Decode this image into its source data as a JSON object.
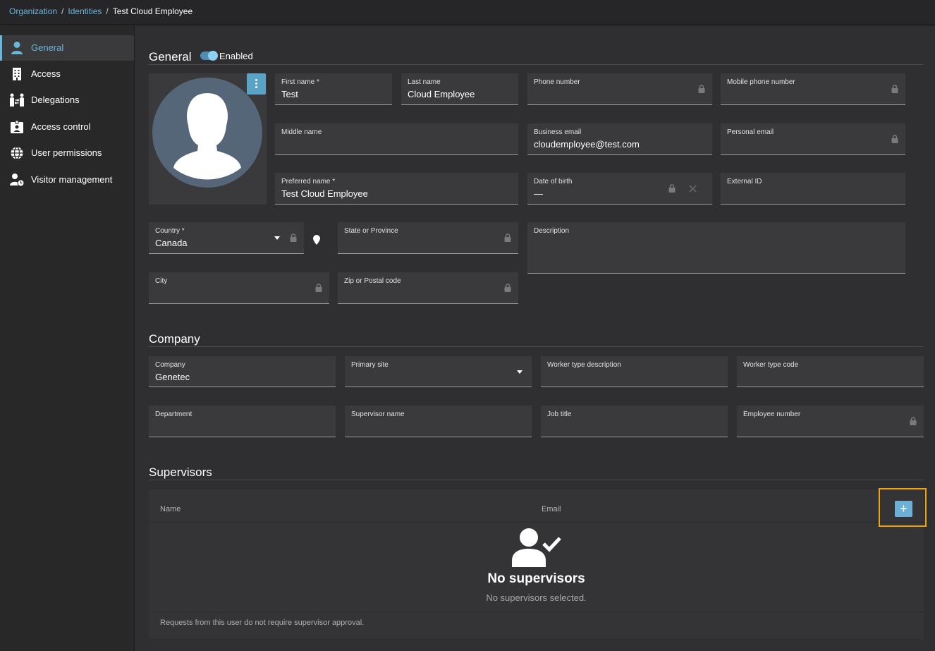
{
  "breadcrumb": {
    "items": [
      "Organization",
      "Identities"
    ],
    "current": "Test Cloud Employee",
    "separator": "/"
  },
  "sidebar": {
    "items": [
      {
        "label": "General",
        "icon": "person-icon",
        "active": true
      },
      {
        "label": "Access",
        "icon": "building-icon"
      },
      {
        "label": "Delegations",
        "icon": "delegation-icon"
      },
      {
        "label": "Access control",
        "icon": "badge-icon"
      },
      {
        "label": "User permissions",
        "icon": "globe-icon"
      },
      {
        "label": "Visitor management",
        "icon": "visitor-icon"
      }
    ]
  },
  "general": {
    "title": "General",
    "enabled_label": "Enabled",
    "enabled": true,
    "fields": {
      "first_name": {
        "label": "First name *",
        "value": "Test"
      },
      "last_name": {
        "label": "Last name",
        "value": "Cloud Employee"
      },
      "phone": {
        "label": "Phone number",
        "value": ""
      },
      "mobile": {
        "label": "Mobile phone number",
        "value": ""
      },
      "middle_name": {
        "label": "Middle name",
        "value": ""
      },
      "business_email": {
        "label": "Business email",
        "value": "cloudemployee@test.com"
      },
      "personal_email": {
        "label": "Personal email",
        "value": ""
      },
      "preferred_name": {
        "label": "Preferred name *",
        "value": "Test Cloud Employee"
      },
      "dob": {
        "label": "Date of birth",
        "value": "—"
      },
      "external_id": {
        "label": "External ID",
        "value": ""
      },
      "country": {
        "label": "Country *",
        "value": "Canada"
      },
      "state": {
        "label": "State or Province",
        "value": ""
      },
      "description": {
        "label": "Description",
        "value": ""
      },
      "city": {
        "label": "City",
        "value": ""
      },
      "zip": {
        "label": "Zip or Postal code",
        "value": ""
      }
    }
  },
  "company": {
    "title": "Company",
    "fields": {
      "company": {
        "label": "Company",
        "value": "Genetec"
      },
      "primary_site": {
        "label": "Primary site",
        "value": ""
      },
      "worker_type_desc": {
        "label": "Worker type description",
        "value": ""
      },
      "worker_type_code": {
        "label": "Worker type code",
        "value": ""
      },
      "department": {
        "label": "Department",
        "value": ""
      },
      "supervisor_name": {
        "label": "Supervisor name",
        "value": ""
      },
      "job_title": {
        "label": "Job title",
        "value": ""
      },
      "employee_number": {
        "label": "Employee number",
        "value": ""
      }
    }
  },
  "supervisors": {
    "title": "Supervisors",
    "columns": [
      "Name",
      "Email"
    ],
    "add_label": "+",
    "empty_title": "No supervisors",
    "empty_subtitle": "No supervisors selected.",
    "footnote": "Requests from this user do not require supervisor approval."
  },
  "colors": {
    "accent": "#6cb6dc",
    "highlight": "#f0a30a",
    "background": "#2f2f31",
    "field": "#3a3a3c"
  }
}
